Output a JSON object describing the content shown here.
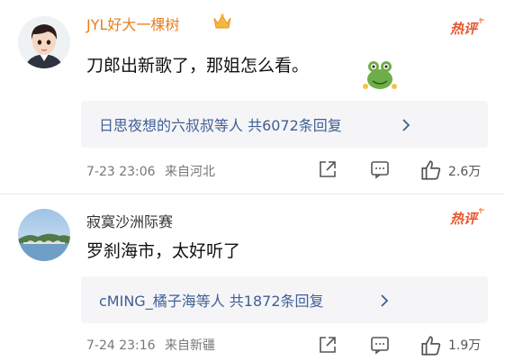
{
  "comments": [
    {
      "username": "JYL好大一棵树",
      "badge": "热评",
      "badge_color": "#e8552d",
      "content": "刀郎出新歌了，那姐怎么看。",
      "reply_summary": "日思夜想的六叔叔等人 共6072条回复",
      "reply_chevron": "›",
      "timestamp": "7-23 23:06",
      "location": "来自河北",
      "like_count": "2.6万",
      "icons": {
        "avatar": "cartoon-boy-avatar",
        "crown": "crown-icon",
        "sticker": "frog-sticker",
        "share": "share-icon",
        "comment": "comment-icon",
        "like": "thumbs-up-icon"
      }
    },
    {
      "username": "寂寞沙洲际赛",
      "badge": "热评",
      "badge_color": "#e8552d",
      "content": "罗刹海市，太好听了",
      "reply_summary": "cMING_橘子海等人 共1872条回复",
      "reply_chevron": "›",
      "timestamp": "7-24 23:16",
      "location": "来自新疆",
      "like_count": "1.9万",
      "icons": {
        "avatar": "landscape-avatar",
        "share": "share-icon",
        "comment": "comment-icon",
        "like": "thumbs-up-icon"
      }
    }
  ],
  "colors": {
    "vip_name": "#ea7e1b",
    "reply_link": "#3f5f96",
    "reply_bg": "#f5f5f7",
    "meta_text": "#777777"
  }
}
